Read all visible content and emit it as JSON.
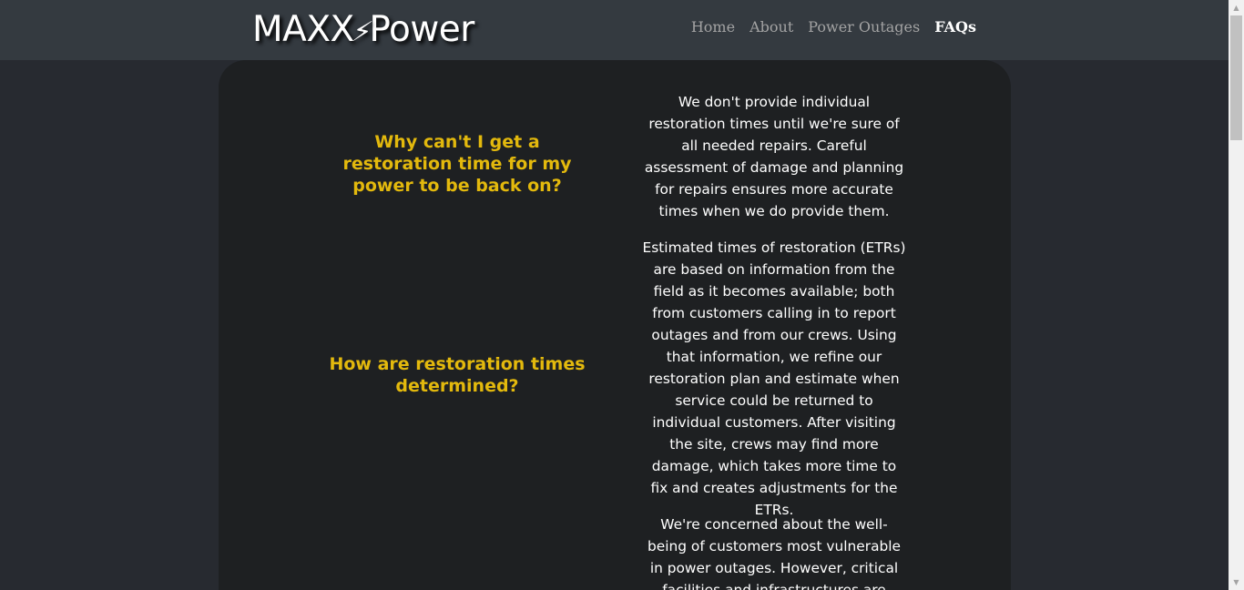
{
  "brand": {
    "logo_left": "MAXX",
    "logo_bolt": "⚡",
    "logo_right": "Power"
  },
  "nav": {
    "items": [
      {
        "label": "Home"
      },
      {
        "label": "About"
      },
      {
        "label": "Power Outages"
      },
      {
        "label": "FAQs",
        "active": true
      }
    ]
  },
  "faqs": [
    {
      "question": "Why can't I get a restoration time for my power to be back on?",
      "answer": "We don't provide individual restoration times until we're sure of all needed repairs. Careful assessment of damage and planning for repairs ensures more accurate times when we do provide them."
    },
    {
      "question": "How are restoration times determined?",
      "answer": "Estimated times of restoration (ETRs) are based on information from the field as it becomes available; both from customers calling in to report outages and from our crews. Using that information, we refine our restoration plan and estimate when service could be returned to individual customers. After visiting the site, crews may find more damage, which takes more time to fix and creates adjustments for the ETRs."
    },
    {
      "question": "",
      "answer": "We're concerned about the well-being of customers most vulnerable in power outages. However, critical facilities and infrastructures are"
    }
  ],
  "colors": {
    "accent": "#e3b90d",
    "navbar": "#343a40",
    "card": "#1e2022",
    "background": "#272a30"
  }
}
